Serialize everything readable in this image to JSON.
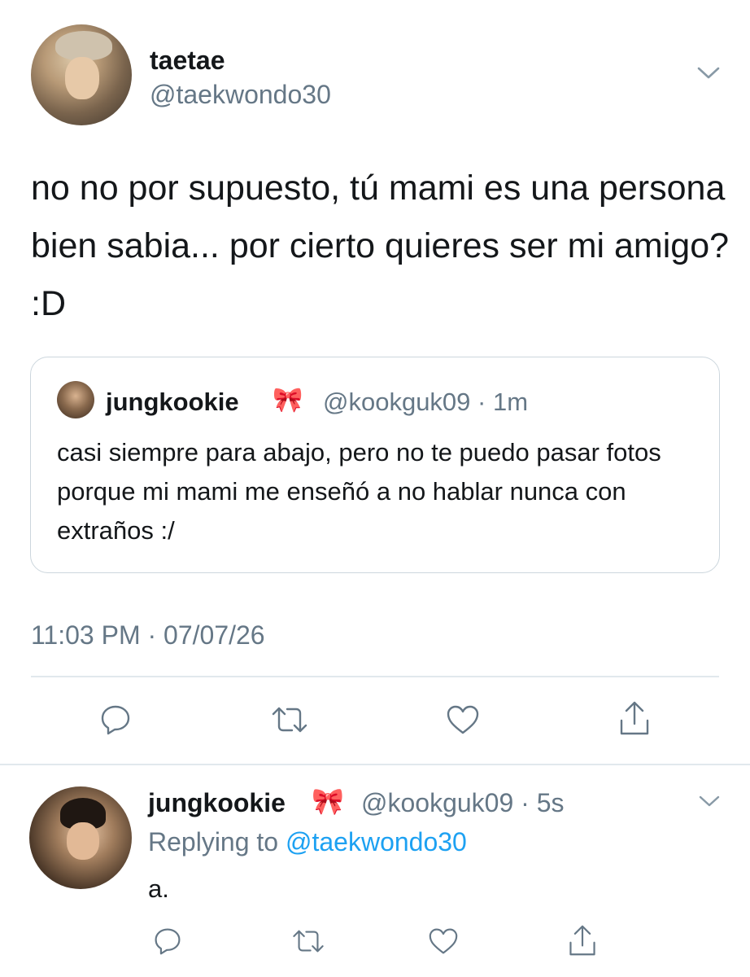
{
  "main_tweet": {
    "display_name": "taetae",
    "handle": "@taekwondo30",
    "text": "no no por supuesto, tú mami es una persona bien sabia... por cierto quieres ser mi amigo? :D",
    "timestamp": "11:03 PM · 07/07/26"
  },
  "quoted_tweet": {
    "display_name": "jungkookie",
    "emoji": "🎀",
    "handle_time": "@kookguk09 · 1m",
    "text": "casi siempre para abajo, pero no te puedo pasar fotos porque mi mami me enseñó a no hablar nunca con extraños :/"
  },
  "reply_tweet": {
    "display_name": "jungkookie",
    "emoji": "🎀",
    "handle_time": "@kookguk09 · 5s",
    "replying_prefix": "Replying to",
    "replying_to": "@taekwondo30",
    "text": "a."
  },
  "actions": {
    "icons": [
      "reply-icon",
      "retweet-icon",
      "like-icon",
      "share-icon"
    ]
  },
  "colors": {
    "text": "#14171a",
    "secondary": "#657786",
    "link": "#1da1f2",
    "border": "#e1e8ed"
  }
}
